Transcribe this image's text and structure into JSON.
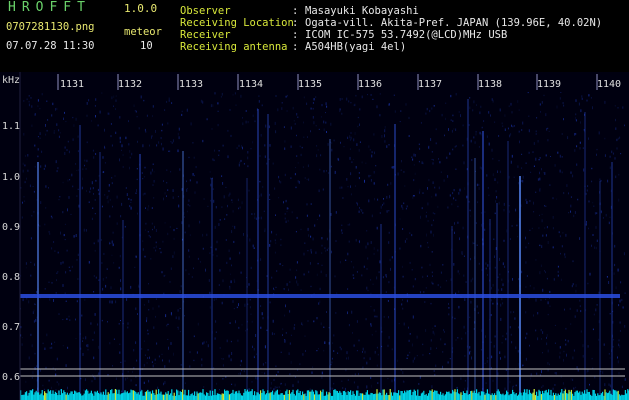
{
  "header": {
    "app_name": "HROFFT",
    "version": "1.0.0",
    "file_name": "0707281130.png",
    "date_time": "07.07.28 11:30",
    "meteor_label": "meteor",
    "meteor_count": "10",
    "fields": [
      {
        "label": "Observer",
        "value": "Masayuki Kobayashi"
      },
      {
        "label": "Receiving Location",
        "value": "Ogata-vill. Akita-Pref. JAPAN (139.96E, 40.02N)"
      },
      {
        "label": "Receiver",
        "value": "ICOM IC-575 53.7492(@LCD)MHz USB"
      },
      {
        "label": "Receiving antenna",
        "value": "A504HB(yagi 4el)"
      }
    ]
  },
  "spectrogram": {
    "unit_label": "kHz",
    "y_labels": [
      "1.1",
      "1.0",
      "0.9",
      "0.8",
      "0.7",
      "0.6"
    ],
    "time_labels": [
      "1131",
      "1132",
      "1133",
      "1134",
      "1135",
      "1136",
      "1137",
      "1138",
      "1139",
      "1140"
    ],
    "colors": {
      "background": "#000014",
      "signal": "#1e3cc8",
      "strong": "#5a8cff",
      "baseline": "#00d4e8",
      "marker": "#c8c8c8"
    }
  }
}
